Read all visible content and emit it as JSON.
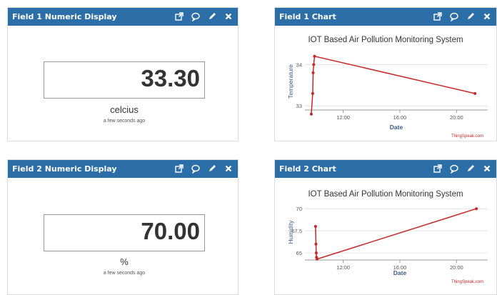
{
  "widgets": {
    "field1_display": {
      "title": "Field 1 Numeric Display",
      "value": "33.30",
      "unit": "celcius",
      "time": "a few seconds ago"
    },
    "field1_chart": {
      "title": "Field 1 Chart",
      "chart_title": "IOT Based Air Pollution Monitoring System",
      "credit": "ThingSpeak.com"
    },
    "field2_display": {
      "title": "Field 2 Numeric Display",
      "value": "70.00",
      "unit": "%",
      "time": "a few seconds ago"
    },
    "field2_chart": {
      "title": "Field 2 Chart",
      "chart_title": "IOT Based Air Pollution Monitoring System",
      "credit": "ThingSpeak.com"
    }
  },
  "icons": [
    "external-link-icon",
    "comment-icon",
    "pencil-icon",
    "close-icon"
  ],
  "colors": {
    "header": "#2c6fa8",
    "series": "#c62828",
    "axis_title": "#3a5a8c"
  },
  "chart_data": [
    {
      "type": "line",
      "title": "IOT Based Air Pollution Monitoring System",
      "xlabel": "Date",
      "ylabel": "Temperature",
      "x_ticks": [
        "12:00",
        "16:00",
        "20:00"
      ],
      "y_ticks": [
        33,
        34
      ],
      "ylim": [
        32.9,
        34.3
      ],
      "x_hours": [
        9.75,
        9.85,
        9.88,
        9.92,
        9.98,
        21.3
      ],
      "values": [
        32.8,
        33.3,
        33.8,
        34.0,
        34.2,
        33.3
      ],
      "series": [
        {
          "name": "",
          "color": "#c62828"
        }
      ]
    },
    {
      "type": "line",
      "title": "IOT Based Air Pollution Monitoring System",
      "xlabel": "Date",
      "ylabel": "Humidity",
      "x_ticks": [
        "12:00",
        "16:00",
        "20:00"
      ],
      "y_ticks": [
        65,
        67.5,
        70
      ],
      "ylim": [
        64.2,
        70.5
      ],
      "x_hours": [
        10.05,
        10.08,
        10.1,
        10.12,
        10.15,
        21.4
      ],
      "values": [
        68,
        66,
        65,
        64.5,
        64.3,
        70
      ],
      "series": [
        {
          "name": "",
          "color": "#c62828"
        }
      ]
    }
  ]
}
